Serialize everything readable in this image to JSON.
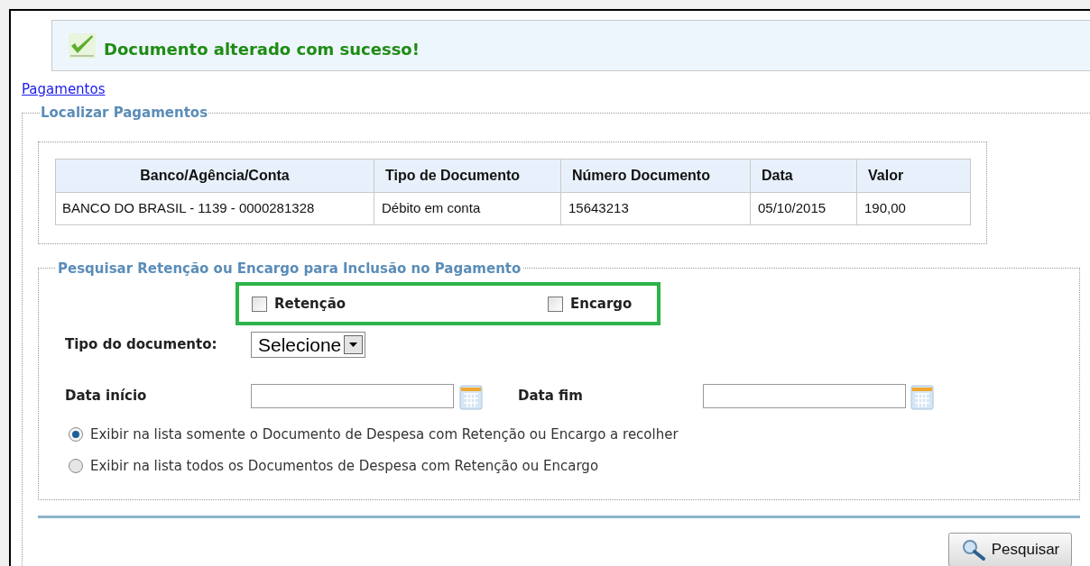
{
  "message": {
    "text": "Documento alterado com sucesso!"
  },
  "breadcrumb": "Pagamentos",
  "localizar": {
    "legend": "Localizar Pagamentos",
    "table": {
      "columns": [
        "Banco/Agência/Conta",
        "Tipo de Documento",
        "Número Documento",
        "Data",
        "Valor"
      ],
      "rows": [
        [
          "BANCO DO BRASIL - 1139 - 0000281328",
          "Débito em conta",
          "15643213",
          "05/10/2015",
          "190,00"
        ]
      ]
    }
  },
  "pesquisar": {
    "legend": "Pesquisar Retenção ou Encargo para Inclusão no Pagamento",
    "checkboxes": [
      {
        "label": "Retenção",
        "checked": false
      },
      {
        "label": "Encargo",
        "checked": false
      }
    ],
    "tipo": {
      "label": "Tipo do documento:",
      "value": "Selecione"
    },
    "data_inicio": {
      "label": "Data início"
    },
    "data_fim": {
      "label": "Data fim"
    },
    "options": [
      {
        "label": "Exibir na lista somente o Documento de Despesa com Retenção ou Encargo a recolher",
        "selected": true
      },
      {
        "label": "Exibir na lista todos os Documentos de Despesa com Retenção ou Encargo",
        "selected": false
      }
    ]
  },
  "button": "Pesquisar"
}
